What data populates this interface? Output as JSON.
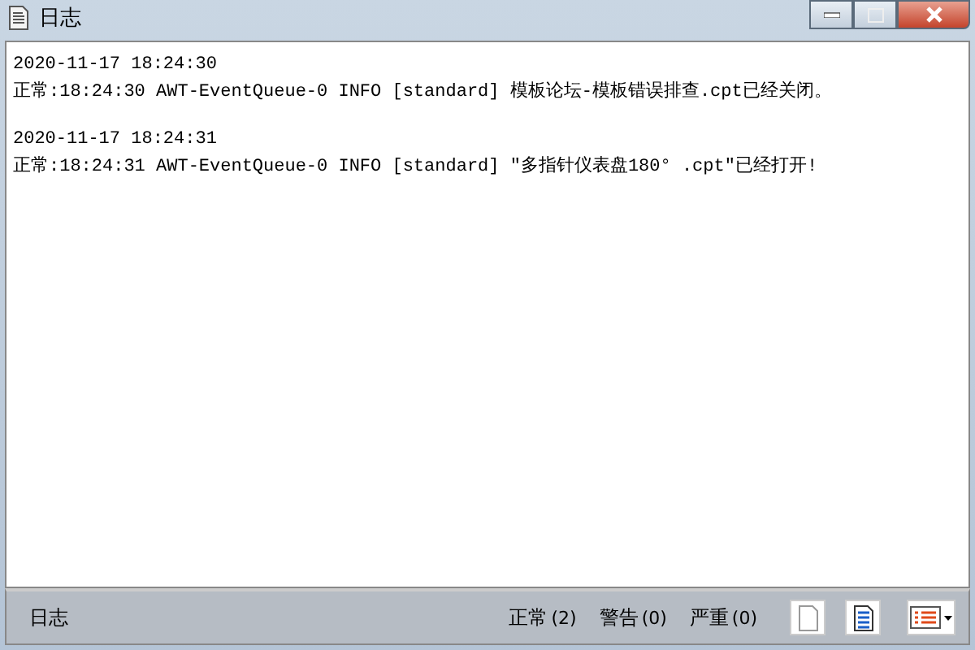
{
  "window": {
    "title": "日志"
  },
  "log_entries": [
    {
      "timestamp": "2020-11-17 18:24:30",
      "message": "正常:18:24:30 AWT-EventQueue-0 INFO [standard] 模板论坛-模板错误排查.cpt已经关闭。"
    },
    {
      "timestamp": "2020-11-17 18:24:31",
      "message": "正常:18:24:31 AWT-EventQueue-0 INFO [standard] \"多指针仪表盘180° .cpt\"已经打开!"
    }
  ],
  "status_bar": {
    "label": "日志",
    "counts": [
      {
        "label": "正常",
        "count": "(2)"
      },
      {
        "label": "警告",
        "count": "(0)"
      },
      {
        "label": "严重",
        "count": "(0)"
      }
    ]
  }
}
